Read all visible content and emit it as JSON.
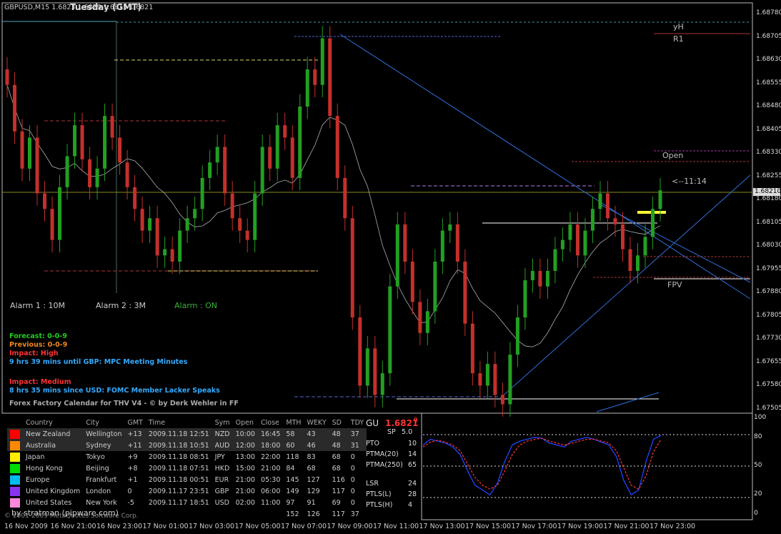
{
  "symbol_header": "GBPUSD,M15  1.6823 1.6829 1.6815 1.6821",
  "day_header": "Tuesday  (GMT)",
  "alarms": {
    "alarm1": "Alarm 1 : 10M",
    "alarm2": "Alarm 2 :  3M",
    "alarm_status": "Alarm :  ON"
  },
  "level_labels": {
    "yh": "yH",
    "r1": "R1",
    "open": "Open",
    "fpv": "FPV",
    "countdown": "<--11:14"
  },
  "news": {
    "forecast": "Forecast: 0-0-9",
    "previous": "Previous: 0-0-9",
    "impact_high": "Impact: High",
    "event1": "9 hrs 39 mins until GBP: MPC Meeting Minutes",
    "impact_medium": "Impact: Medium",
    "event2": "8 hrs 35 mins since USD: FOMC Member Lacker Speaks",
    "credit": "Forex Factory Calendar for THV V4 - © by Derk Wehler in FF"
  },
  "colors": {
    "bull": "#22a022",
    "bear": "#c4302b",
    "trendline": "#2e6fd8",
    "ma": "#b0b0b0",
    "pivot_red": "#a33",
    "yellow": "#ffff33",
    "current_price": "#8a8a1e"
  },
  "chart_data": [
    {
      "type": "candlestick",
      "title": "GBPUSD,M15",
      "ylim": [
        1.675,
        1.6878
      ],
      "y_ticks": [
        "1.68780",
        "1.68705",
        "1.68630",
        "1.68555",
        "1.68480",
        "1.68405",
        "1.68330",
        "1.68255",
        "1.68180",
        "1.68105",
        "1.68030",
        "1.67955",
        "1.67880",
        "1.67805",
        "1.67730",
        "1.67655",
        "1.67580",
        "1.67505"
      ],
      "current_price": "1.68210",
      "x_ticks": [
        "16 Nov 2009",
        "16 Nov 21:00",
        "16 Nov 23:00",
        "17 Nov 01:00",
        "17 Nov 03:00",
        "17 Nov 05:00",
        "17 Nov 07:00",
        "17 Nov 09:00",
        "17 Nov 11:00",
        "17 Nov 13:00",
        "17 Nov 15:00",
        "17 Nov 17:00",
        "17 Nov 19:00",
        "17 Nov 21:00",
        "17 Nov 23:00"
      ],
      "candles_close": [
        1.6855,
        1.684,
        1.6828,
        1.6838,
        1.682,
        1.6815,
        1.6805,
        1.6822,
        1.6832,
        1.6842,
        1.6831,
        1.6822,
        1.6828,
        1.6845,
        1.6838,
        1.683,
        1.6822,
        1.6815,
        1.6808,
        1.6812,
        1.68,
        1.6802,
        1.6798,
        1.6808,
        1.6812,
        1.6815,
        1.6825,
        1.683,
        1.6835,
        1.682,
        1.6812,
        1.6808,
        1.6805,
        1.682,
        1.6835,
        1.6828,
        1.6842,
        1.6838,
        1.6825,
        1.6848,
        1.686,
        1.6855,
        1.687,
        1.6845,
        1.6825,
        1.6812,
        1.678,
        1.6758,
        1.677,
        1.6755,
        1.6762,
        1.679,
        1.681,
        1.6798,
        1.6785,
        1.6775,
        1.6782,
        1.6798,
        1.6808,
        1.681,
        1.6798,
        1.6778,
        1.6762,
        1.6758,
        1.6765,
        1.6755,
        1.6752,
        1.6768,
        1.678,
        1.6792,
        1.6795,
        1.679,
        1.6795,
        1.6802,
        1.6805,
        1.681,
        1.68,
        1.6808,
        1.6815,
        1.682,
        1.6812,
        1.681,
        1.6802,
        1.6795,
        1.68,
        1.6806,
        1.6815,
        1.6821
      ],
      "candles_open": [
        1.686,
        1.6855,
        1.684,
        1.6828,
        1.6838,
        1.682,
        1.6815,
        1.6805,
        1.6822,
        1.6832,
        1.6842,
        1.6831,
        1.6822,
        1.6828,
        1.6845,
        1.6838,
        1.683,
        1.6822,
        1.6815,
        1.6808,
        1.6812,
        1.68,
        1.6802,
        1.6798,
        1.6808,
        1.6812,
        1.6815,
        1.6825,
        1.683,
        1.6835,
        1.682,
        1.6812,
        1.6808,
        1.6805,
        1.682,
        1.6835,
        1.6828,
        1.6842,
        1.6838,
        1.6825,
        1.6848,
        1.686,
        1.6855,
        1.687,
        1.6845,
        1.6825,
        1.6812,
        1.678,
        1.6758,
        1.677,
        1.6755,
        1.6762,
        1.679,
        1.681,
        1.6798,
        1.6785,
        1.6775,
        1.6782,
        1.6798,
        1.6808,
        1.681,
        1.6798,
        1.6778,
        1.6762,
        1.6758,
        1.6765,
        1.6755,
        1.6752,
        1.6768,
        1.678,
        1.6792,
        1.6795,
        1.679,
        1.6795,
        1.6802,
        1.6805,
        1.681,
        1.68,
        1.6808,
        1.6815,
        1.682,
        1.6812,
        1.681,
        1.6802,
        1.6795,
        1.68,
        1.6806,
        1.6815
      ]
    },
    {
      "type": "line",
      "title": "GU 1.6821",
      "ylim": [
        0,
        100
      ],
      "y_ticks": [
        "100",
        "80",
        "50",
        "20",
        "0"
      ],
      "series": [
        {
          "name": "",
          "values": [
            72,
            78,
            76,
            74,
            70,
            62,
            45,
            30,
            25,
            20,
            32,
            55,
            72,
            76,
            78,
            80,
            79,
            74,
            72,
            70,
            76,
            78,
            80,
            78,
            75,
            72,
            60,
            35,
            20,
            25,
            55,
            78,
            82
          ]
        },
        {
          "name": "",
          "values": [
            70,
            75,
            77,
            75,
            72,
            66,
            52,
            38,
            30,
            26,
            30,
            45,
            62,
            72,
            76,
            78,
            79,
            76,
            74,
            72,
            74,
            76,
            78,
            78,
            76,
            74,
            66,
            48,
            30,
            26,
            40,
            65,
            78
          ]
        }
      ]
    }
  ],
  "indicator_panel": {
    "gu_label": "GU",
    "gu_price": "1.6821",
    "gu_price_sup": "0",
    "sp_label": "SP",
    "sp_value": "5.0",
    "rows": [
      {
        "label": "PTO",
        "value": "10"
      },
      {
        "label": "PTMA(20)",
        "value": "14"
      },
      {
        "label": "PTMA(250)",
        "value": "65"
      },
      {
        "label": "LSR",
        "value": "24"
      },
      {
        "label": "PTLS(L)",
        "value": "28"
      },
      {
        "label": "PTLS(H)",
        "value": "4"
      }
    ]
  },
  "timezone_table": {
    "headers": [
      "",
      "Country",
      "City",
      "GMT",
      "Time",
      "Sym",
      "Open",
      "Close",
      "MTH",
      "WEKY",
      "SD",
      "TDY"
    ],
    "rows": [
      {
        "color": "#ff0000",
        "country": "New Zealand",
        "city": "Wellington",
        "gmt": "+13",
        "time": "2009.11.18 12:51",
        "sym": "NZD",
        "open": "10:00",
        "close": "16:45",
        "mth": "58",
        "weky": "43",
        "sd": "48",
        "tdy": "37"
      },
      {
        "color": "#ff8800",
        "country": "Australia",
        "city": "Sydney",
        "gmt": "+11",
        "time": "2009.11.18 10:51",
        "sym": "AUD",
        "open": "12:00",
        "close": "18:00",
        "mth": "60",
        "weky": "46",
        "sd": "48",
        "tdy": "31"
      },
      {
        "color": "#ffee00",
        "country": "Japan",
        "city": "Tokyo",
        "gmt": "+9",
        "time": "2009.11.18 08:51",
        "sym": "JPY",
        "open": "13:00",
        "close": "22:00",
        "mth": "118",
        "weky": "83",
        "sd": "68",
        "tdy": "0"
      },
      {
        "color": "#00dd00",
        "country": "Hong Kong",
        "city": "Beijing",
        "gmt": "+8",
        "time": "2009.11.18 07:51",
        "sym": "HKD",
        "open": "15:00",
        "close": "21:00",
        "mth": "84",
        "weky": "68",
        "sd": "68",
        "tdy": "0"
      },
      {
        "color": "#00bbee",
        "country": "Europe",
        "city": "Frankfurt",
        "gmt": "+1",
        "time": "2009.11.18 00:51",
        "sym": "EUR",
        "open": "21:00",
        "close": "05:30",
        "mth": "145",
        "weky": "127",
        "sd": "116",
        "tdy": "0"
      },
      {
        "color": "#8833ee",
        "country": "United Kingdom",
        "city": "London",
        "gmt": "0",
        "time": "2009.11.17 23:51",
        "sym": "GBP",
        "open": "21:00",
        "close": "06:00",
        "mth": "149",
        "weky": "129",
        "sd": "117",
        "tdy": "0"
      },
      {
        "color": "#ff88dd",
        "country": "United States",
        "city": "New York",
        "gmt": "-5",
        "time": "2009.11.17 18:51",
        "sym": "USD",
        "open": "02:00",
        "close": "11:00",
        "mth": "97",
        "weky": "91",
        "sd": "69",
        "tdy": "0"
      }
    ],
    "totals": {
      "mth": "152",
      "weky": "126",
      "sd": "117",
      "tdy": "37"
    }
  },
  "footer": {
    "copyright": "© 2001-2009 MetaQuotes Software Corp.",
    "author": "by stratman (pipware.com)"
  }
}
